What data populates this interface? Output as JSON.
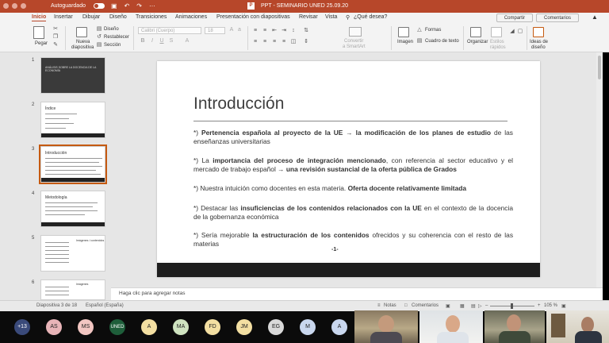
{
  "titlebar": {
    "autosave_label": "Autoguardado",
    "document_title": "PPT - SEMINARIO UNED 25.09.20",
    "save_glyph": "▣",
    "undo_glyph": "↶",
    "redo_glyph": "↷",
    "more_glyph": "···",
    "app_icon_letter": "P"
  },
  "ribbon_tabs": [
    "Inicio",
    "Insertar",
    "Dibujar",
    "Diseño",
    "Transiciones",
    "Animaciones",
    "Presentación con diapositivas",
    "Revisar",
    "Vista"
  ],
  "tell_me": "¿Qué desea?",
  "share_label": "Compartir",
  "comments_label": "Comentarios",
  "ribbon": {
    "paste": "Pegar",
    "new_slide_1": "Nueva",
    "new_slide_2": "diapositiva",
    "layout": "Diseño",
    "reset": "Restablecer",
    "section": "Sección",
    "font_placeholder": "Calibri (Cuerpo)",
    "size_placeholder": "18",
    "convert_1": "Convertir",
    "convert_2": "a SmartArt",
    "image": "Imagen",
    "shapes": "Formas",
    "textbox": "Cuadro de texto",
    "arrange": "Organizar",
    "quick_styles_1": "Estilos",
    "quick_styles_2": "rápidos",
    "design_ideas_1": "Ideas de",
    "design_ideas_2": "diseño"
  },
  "thumbnails": [
    {
      "num": "1",
      "title": "ANÁLISIS SOBRE LA DOCENCIA DE LA ECONOMÍA"
    },
    {
      "num": "2",
      "title": "Índice"
    },
    {
      "num": "3",
      "title": "Introducción"
    },
    {
      "num": "4",
      "title": "Metodología"
    },
    {
      "num": "5",
      "title": "Imágenes / contenidos"
    },
    {
      "num": "6",
      "title": "Imágenes"
    }
  ],
  "slide": {
    "title": "Introducción",
    "bullets": [
      {
        "pre": "*) ",
        "b1": "Pertenencia española al proyecto de la UE",
        "mid": " → ",
        "b2": "la modificación de los planes de estudio",
        "post": " de las enseñanzas universitarias"
      },
      {
        "pre": "*) La ",
        "b1": "importancia del proceso de integración mencionado",
        "mid": ", con referencia al sector educativo y el mercado de trabajo español → ",
        "b2": "una revisión sustancial de la oferta pública de Grados",
        "post": ""
      },
      {
        "pre": "*) Nuestra intuición como docentes en esta materia.  ",
        "b1": "Oferta docente relativamente limitada",
        "mid": "",
        "b2": "",
        "post": ""
      },
      {
        "pre": "*) Destacar las ",
        "b1": "insuficiencias de los contenidos relacionados con la UE",
        "mid": " en el contexto de la docencia de la gobernanza económica",
        "b2": "",
        "post": ""
      },
      {
        "pre": "*) Sería mejorable ",
        "b1": "la estructuración de los contenidos",
        "mid": " ofrecidos y su coherencia con el resto de las materias",
        "b2": "",
        "post": ""
      }
    ],
    "page_number": "-1-"
  },
  "notes_placeholder": "Haga clic para agregar notas",
  "status": {
    "slide_count": "Diapositiva 3 de 18",
    "language": "Español (España)",
    "notes": "Notas",
    "comments": "Comentarios",
    "zoom": "105 %"
  },
  "participants": [
    {
      "initials": "+13",
      "color": "#3a4a7a"
    },
    {
      "initials": "AS",
      "color": "#e8b4b8"
    },
    {
      "initials": "MS",
      "color": "#f2c6c2"
    },
    {
      "initials": "UNED",
      "color": "#1e5e3a"
    },
    {
      "initials": "A",
      "color": "#f3dfa2"
    },
    {
      "initials": "MA",
      "color": "#cfe3c0"
    },
    {
      "initials": "FD",
      "color": "#f3dfa2"
    },
    {
      "initials": "JM",
      "color": "#f3dfa2"
    },
    {
      "initials": "EG",
      "color": "#d9d9d9"
    },
    {
      "initials": "M",
      "color": "#c9d7ee"
    },
    {
      "initials": "A",
      "color": "#c9d7ee"
    }
  ],
  "colors": {
    "accent": "#b7472a",
    "selection": "#c55a11"
  }
}
